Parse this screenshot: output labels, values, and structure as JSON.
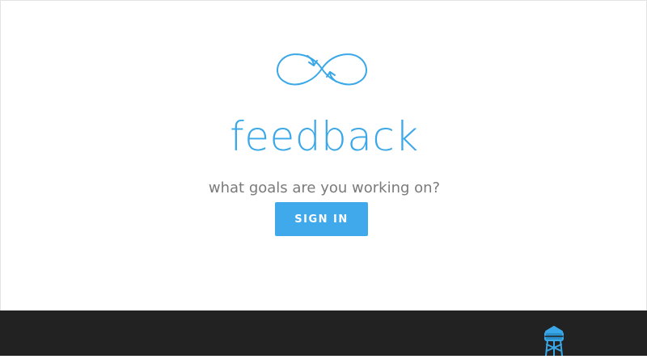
{
  "brand": {
    "logo_icon": "infinity-loop-arrows-icon",
    "title": "feedback",
    "tagline": "what goals are you working on?"
  },
  "actions": {
    "signin_label": "SIGN IN"
  },
  "footer": {
    "icon": "water-tower-icon"
  },
  "colors": {
    "accent": "#3aa8e8",
    "button": "#3fa9ec",
    "tagline_text": "#7a7a7a",
    "footer_bg": "#222222"
  }
}
